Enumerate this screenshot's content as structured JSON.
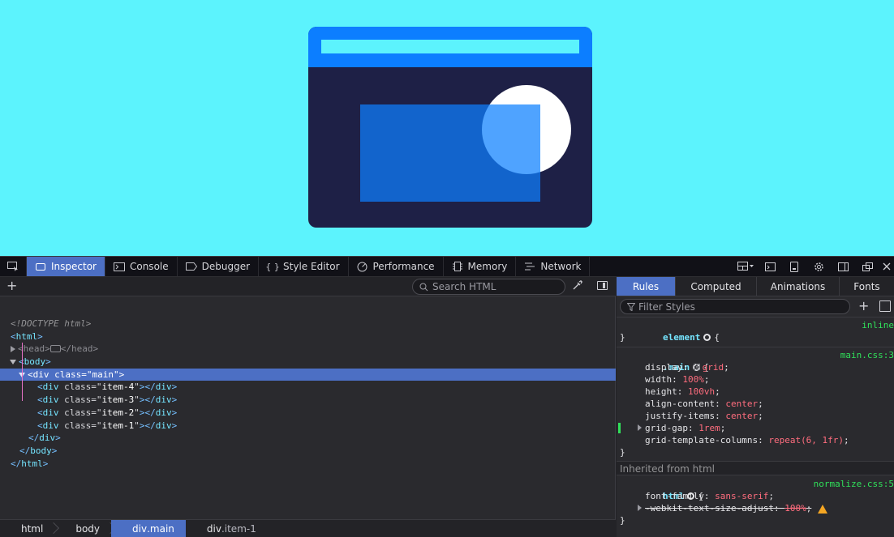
{
  "devtools": {
    "tabs": [
      {
        "label": "Inspector",
        "icon": "inspector-icon"
      },
      {
        "label": "Console",
        "icon": "console-icon"
      },
      {
        "label": "Debugger",
        "icon": "debugger-icon"
      },
      {
        "label": "Style Editor",
        "icon": "style-editor-icon"
      },
      {
        "label": "Performance",
        "icon": "performance-icon"
      },
      {
        "label": "Memory",
        "icon": "memory-icon"
      },
      {
        "label": "Network",
        "icon": "network-icon"
      }
    ],
    "active_tab": "Inspector",
    "accent_color": "#4c6fc4"
  },
  "inspector": {
    "search_placeholder": "Search HTML",
    "markup": {
      "doctype": "<!DOCTYPE html>",
      "html_open": "html",
      "head": "head",
      "body": "body",
      "main_div_class": "main",
      "children": [
        "item-4",
        "item-3",
        "item-2",
        "item-1"
      ]
    },
    "breadcrumbs": [
      {
        "tag": "html",
        "cls": ""
      },
      {
        "tag": "body",
        "cls": ""
      },
      {
        "tag": "div",
        "cls": ".main"
      },
      {
        "tag": "div",
        "cls": ".item-1"
      }
    ]
  },
  "rules_panel": {
    "tabs": [
      "Rules",
      "Computed",
      "Animations",
      "Fonts"
    ],
    "active_tab": "Rules",
    "filter_placeholder": "Filter Styles",
    "element_rule": {
      "selector": "element",
      "source": "inline"
    },
    "main_rule": {
      "selector": ".main",
      "source": "main.css:3",
      "declarations": [
        {
          "prop": "display",
          "value": "grid"
        },
        {
          "prop": "width",
          "value": "100%"
        },
        {
          "prop": "height",
          "value": "100vh"
        },
        {
          "prop": "align-content",
          "value": "center"
        },
        {
          "prop": "justify-items",
          "value": "center"
        },
        {
          "prop": "grid-gap",
          "value": "1rem"
        },
        {
          "prop": "grid-template-columns",
          "value": "repeat(6, 1fr)"
        }
      ]
    },
    "inherited_label": "Inherited from html",
    "html_rule": {
      "selector": "html",
      "source": "normalize.css:5",
      "declarations": [
        {
          "prop": "font-family",
          "value": "sans-serif"
        },
        {
          "prop": "-webkit-text-size-adjust",
          "value": "100%"
        }
      ]
    }
  }
}
